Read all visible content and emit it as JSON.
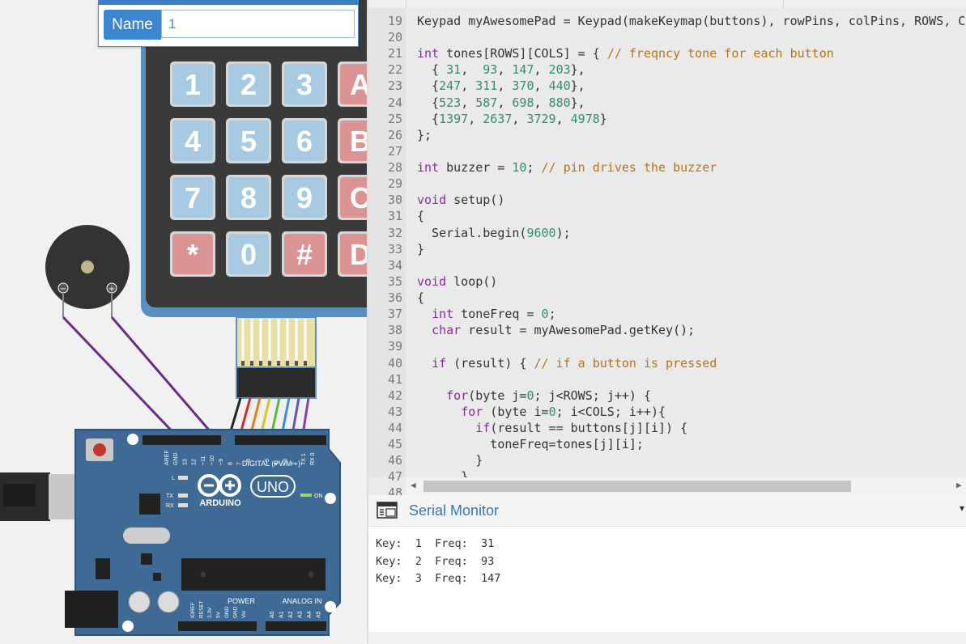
{
  "name_popup": {
    "label": "Name",
    "value": "1"
  },
  "keypad": {
    "keys": [
      [
        {
          "label": "1",
          "type": "num"
        },
        {
          "label": "2",
          "type": "num"
        },
        {
          "label": "3",
          "type": "num"
        },
        {
          "label": "A",
          "type": "func"
        }
      ],
      [
        {
          "label": "4",
          "type": "num"
        },
        {
          "label": "5",
          "type": "num"
        },
        {
          "label": "6",
          "type": "num"
        },
        {
          "label": "B",
          "type": "func"
        }
      ],
      [
        {
          "label": "7",
          "type": "num"
        },
        {
          "label": "8",
          "type": "num"
        },
        {
          "label": "9",
          "type": "num"
        },
        {
          "label": "C",
          "type": "func"
        }
      ],
      [
        {
          "label": "*",
          "type": "func"
        },
        {
          "label": "0",
          "type": "num"
        },
        {
          "label": "#",
          "type": "func"
        },
        {
          "label": "D",
          "type": "func"
        }
      ]
    ],
    "num_color": "#a7c9e2",
    "func_color": "#dc9393",
    "body_color": "#3a3a3a"
  },
  "buzzer": {
    "minus_label": "−",
    "plus_label": "+"
  },
  "ribbon_colors": [
    "#222222",
    "#d62a2a",
    "#e87b1e",
    "#d9c51d",
    "#5cb936",
    "#3b8fd6",
    "#6a52b5",
    "#8a3fa8"
  ],
  "buzzer_wire_color": "#6a2c8a",
  "arduino": {
    "board_color": "#3f6a95",
    "brand": "ARDUINO",
    "model": "UNO",
    "digital_label": "DIGITAL (PWM ~)",
    "power_label": "POWER",
    "analog_label": "ANALOG IN",
    "on_label": "ON",
    "l_label": "L",
    "tx_label": "TX",
    "rx_label": "RX",
    "top_pins": [
      "AREF",
      "GND",
      "13",
      "12",
      "~11",
      "~10",
      "~9",
      "8",
      "7",
      "~6",
      "~5",
      "4",
      "~3",
      "2",
      "TX 1",
      "RX 0"
    ],
    "power_pins": [
      "IOREF",
      "RESET",
      "3.3V",
      "5V",
      "GND",
      "GND",
      "Vin"
    ],
    "analog_pins": [
      "A0",
      "A1",
      "A2",
      "A3",
      "A4",
      "A5"
    ]
  },
  "editor": {
    "lines": [
      {
        "n": "19",
        "parts": [
          {
            "t": "Keypad myAwesomePad = Keypad(makeKeymap(buttons), rowPins, colPins, ROWS, COLS);",
            "c": ""
          }
        ]
      },
      {
        "n": "20",
        "parts": []
      },
      {
        "n": "21",
        "parts": [
          {
            "t": "int",
            "c": "kw"
          },
          {
            "t": " tones[ROWS][COLS] = { ",
            "c": ""
          },
          {
            "t": "// freqncy tone for each button",
            "c": "cm"
          }
        ]
      },
      {
        "n": "22",
        "parts": [
          {
            "t": "  { ",
            "c": ""
          },
          {
            "t": "31",
            "c": "nm"
          },
          {
            "t": ",  ",
            "c": ""
          },
          {
            "t": "93",
            "c": "nm"
          },
          {
            "t": ", ",
            "c": ""
          },
          {
            "t": "147",
            "c": "nm"
          },
          {
            "t": ", ",
            "c": ""
          },
          {
            "t": "203",
            "c": "nm"
          },
          {
            "t": "},",
            "c": ""
          }
        ]
      },
      {
        "n": "23",
        "parts": [
          {
            "t": "  {",
            "c": ""
          },
          {
            "t": "247",
            "c": "nm"
          },
          {
            "t": ", ",
            "c": ""
          },
          {
            "t": "311",
            "c": "nm"
          },
          {
            "t": ", ",
            "c": ""
          },
          {
            "t": "370",
            "c": "nm"
          },
          {
            "t": ", ",
            "c": ""
          },
          {
            "t": "440",
            "c": "nm"
          },
          {
            "t": "},",
            "c": ""
          }
        ]
      },
      {
        "n": "24",
        "parts": [
          {
            "t": "  {",
            "c": ""
          },
          {
            "t": "523",
            "c": "nm"
          },
          {
            "t": ", ",
            "c": ""
          },
          {
            "t": "587",
            "c": "nm"
          },
          {
            "t": ", ",
            "c": ""
          },
          {
            "t": "698",
            "c": "nm"
          },
          {
            "t": ", ",
            "c": ""
          },
          {
            "t": "880",
            "c": "nm"
          },
          {
            "t": "},",
            "c": ""
          }
        ]
      },
      {
        "n": "25",
        "parts": [
          {
            "t": "  {",
            "c": ""
          },
          {
            "t": "1397",
            "c": "nm"
          },
          {
            "t": ", ",
            "c": ""
          },
          {
            "t": "2637",
            "c": "nm"
          },
          {
            "t": ", ",
            "c": ""
          },
          {
            "t": "3729",
            "c": "nm"
          },
          {
            "t": ", ",
            "c": ""
          },
          {
            "t": "4978",
            "c": "nm"
          },
          {
            "t": "}",
            "c": ""
          }
        ]
      },
      {
        "n": "26",
        "parts": [
          {
            "t": "};",
            "c": ""
          }
        ]
      },
      {
        "n": "27",
        "parts": []
      },
      {
        "n": "28",
        "parts": [
          {
            "t": "int",
            "c": "kw"
          },
          {
            "t": " buzzer = ",
            "c": ""
          },
          {
            "t": "10",
            "c": "nm"
          },
          {
            "t": "; ",
            "c": ""
          },
          {
            "t": "// pin drives the buzzer",
            "c": "cm"
          }
        ]
      },
      {
        "n": "29",
        "parts": []
      },
      {
        "n": "30",
        "parts": [
          {
            "t": "void",
            "c": "kw"
          },
          {
            "t": " setup()",
            "c": ""
          }
        ]
      },
      {
        "n": "31",
        "parts": [
          {
            "t": "{",
            "c": ""
          }
        ]
      },
      {
        "n": "32",
        "parts": [
          {
            "t": "  Serial.begin(",
            "c": ""
          },
          {
            "t": "9600",
            "c": "nm"
          },
          {
            "t": ");",
            "c": ""
          }
        ]
      },
      {
        "n": "33",
        "parts": [
          {
            "t": "}",
            "c": ""
          }
        ]
      },
      {
        "n": "34",
        "parts": []
      },
      {
        "n": "35",
        "parts": [
          {
            "t": "void",
            "c": "kw"
          },
          {
            "t": " loop()",
            "c": ""
          }
        ]
      },
      {
        "n": "36",
        "parts": [
          {
            "t": "{",
            "c": ""
          }
        ]
      },
      {
        "n": "37",
        "parts": [
          {
            "t": "  ",
            "c": ""
          },
          {
            "t": "int",
            "c": "kw"
          },
          {
            "t": " toneFreq = ",
            "c": ""
          },
          {
            "t": "0",
            "c": "nm"
          },
          {
            "t": ";",
            "c": ""
          }
        ]
      },
      {
        "n": "38",
        "parts": [
          {
            "t": "  ",
            "c": ""
          },
          {
            "t": "char",
            "c": "kw"
          },
          {
            "t": " result = myAwesomePad.getKey();",
            "c": ""
          }
        ]
      },
      {
        "n": "39",
        "parts": []
      },
      {
        "n": "40",
        "parts": [
          {
            "t": "  ",
            "c": ""
          },
          {
            "t": "if",
            "c": "kw"
          },
          {
            "t": " (result) { ",
            "c": ""
          },
          {
            "t": "// if a button is pressed",
            "c": "cm"
          }
        ]
      },
      {
        "n": "41",
        "parts": []
      },
      {
        "n": "42",
        "parts": [
          {
            "t": "    ",
            "c": ""
          },
          {
            "t": "for",
            "c": "kw"
          },
          {
            "t": "(byte j=",
            "c": ""
          },
          {
            "t": "0",
            "c": "nm"
          },
          {
            "t": "; j<ROWS; j++) {",
            "c": ""
          }
        ]
      },
      {
        "n": "43",
        "parts": [
          {
            "t": "      ",
            "c": ""
          },
          {
            "t": "for",
            "c": "kw"
          },
          {
            "t": " (byte i=",
            "c": ""
          },
          {
            "t": "0",
            "c": "nm"
          },
          {
            "t": "; i<COLS; i++){",
            "c": ""
          }
        ]
      },
      {
        "n": "44",
        "parts": [
          {
            "t": "        ",
            "c": ""
          },
          {
            "t": "if",
            "c": "kw"
          },
          {
            "t": "(result == buttons[j][i]) {",
            "c": ""
          }
        ]
      },
      {
        "n": "45",
        "parts": [
          {
            "t": "          toneFreq=tones[j][i];",
            "c": ""
          }
        ]
      },
      {
        "n": "46",
        "parts": [
          {
            "t": "        }",
            "c": ""
          }
        ]
      },
      {
        "n": "47",
        "parts": [
          {
            "t": "      }",
            "c": ""
          }
        ]
      },
      {
        "n": "48",
        "parts": []
      }
    ]
  },
  "serial_monitor": {
    "title": "Serial Monitor",
    "output": [
      "Key:  1  Freq:  31",
      "Key:  2  Freq:  93",
      "Key:  3  Freq:  147"
    ]
  }
}
